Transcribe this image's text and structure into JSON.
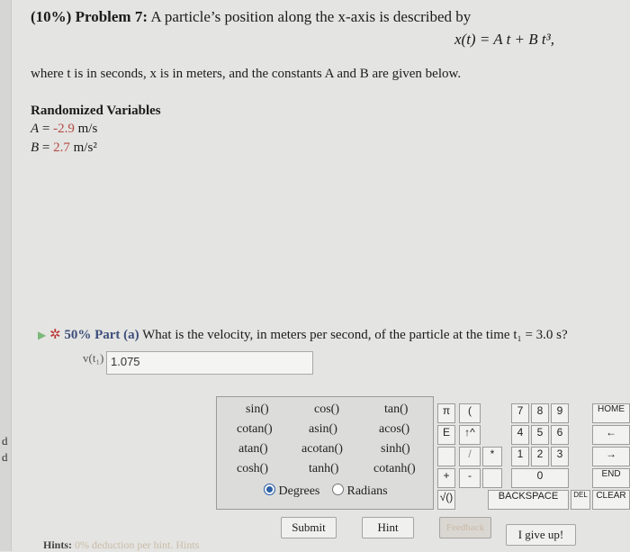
{
  "problem": {
    "weight": "(10%)",
    "label": "Problem 7:",
    "text": "A particle’s position along the x-axis is described by",
    "equation": "x(t) = A t + B t³,",
    "where": "where t is in seconds, x is in meters, and the constants A and B are given below."
  },
  "randomized": {
    "heading": "Randomized Variables",
    "vars": [
      {
        "sym": "A",
        "eq": " = ",
        "val": "-2.9",
        "unit": " m/s"
      },
      {
        "sym": "B",
        "eq": " = ",
        "val": "2.7",
        "unit": " m/s²"
      }
    ]
  },
  "part": {
    "percent": "50% Part (a)",
    "question": "What is the velocity, in meters per second, of the particle at the time t₁ = 3.0 s?",
    "answer_label": "v(t₁) =",
    "answer_value": "1.075"
  },
  "functions": {
    "rows": [
      [
        "sin()",
        "cos()",
        "tan()"
      ],
      [
        "cotan()",
        "asin()",
        "acos()"
      ],
      [
        "atan()",
        "acotan()",
        "sinh()"
      ],
      [
        "cosh()",
        "tanh()",
        "cotanh()"
      ]
    ],
    "degrees": "Degrees",
    "radians": "Radians",
    "mode": "Degrees"
  },
  "keypad": {
    "col_left": [
      "π",
      "E",
      "",
      "+",
      "√()"
    ],
    "col_paren": [
      "(",
      "↑^",
      "/",
      "-",
      ""
    ],
    "col_star": [
      "",
      "",
      "*",
      "",
      ""
    ],
    "digits": [
      [
        "7",
        "8",
        "9"
      ],
      [
        "4",
        "5",
        "6"
      ],
      [
        "1",
        "2",
        "3"
      ]
    ],
    "zero": "0",
    "right": [
      "HOME",
      "←",
      "→",
      "END",
      "CLEAR"
    ],
    "backspace": "BACKSPACE",
    "del": "DEL"
  },
  "buttons": {
    "submit": "Submit",
    "hint": "Hint",
    "feedback": "Feedback",
    "give_up": "I give up!"
  },
  "hints": {
    "label": "Hints:",
    "text": "0% deduction per hint. Hints"
  },
  "left_strip": [
    "d",
    "d"
  ]
}
